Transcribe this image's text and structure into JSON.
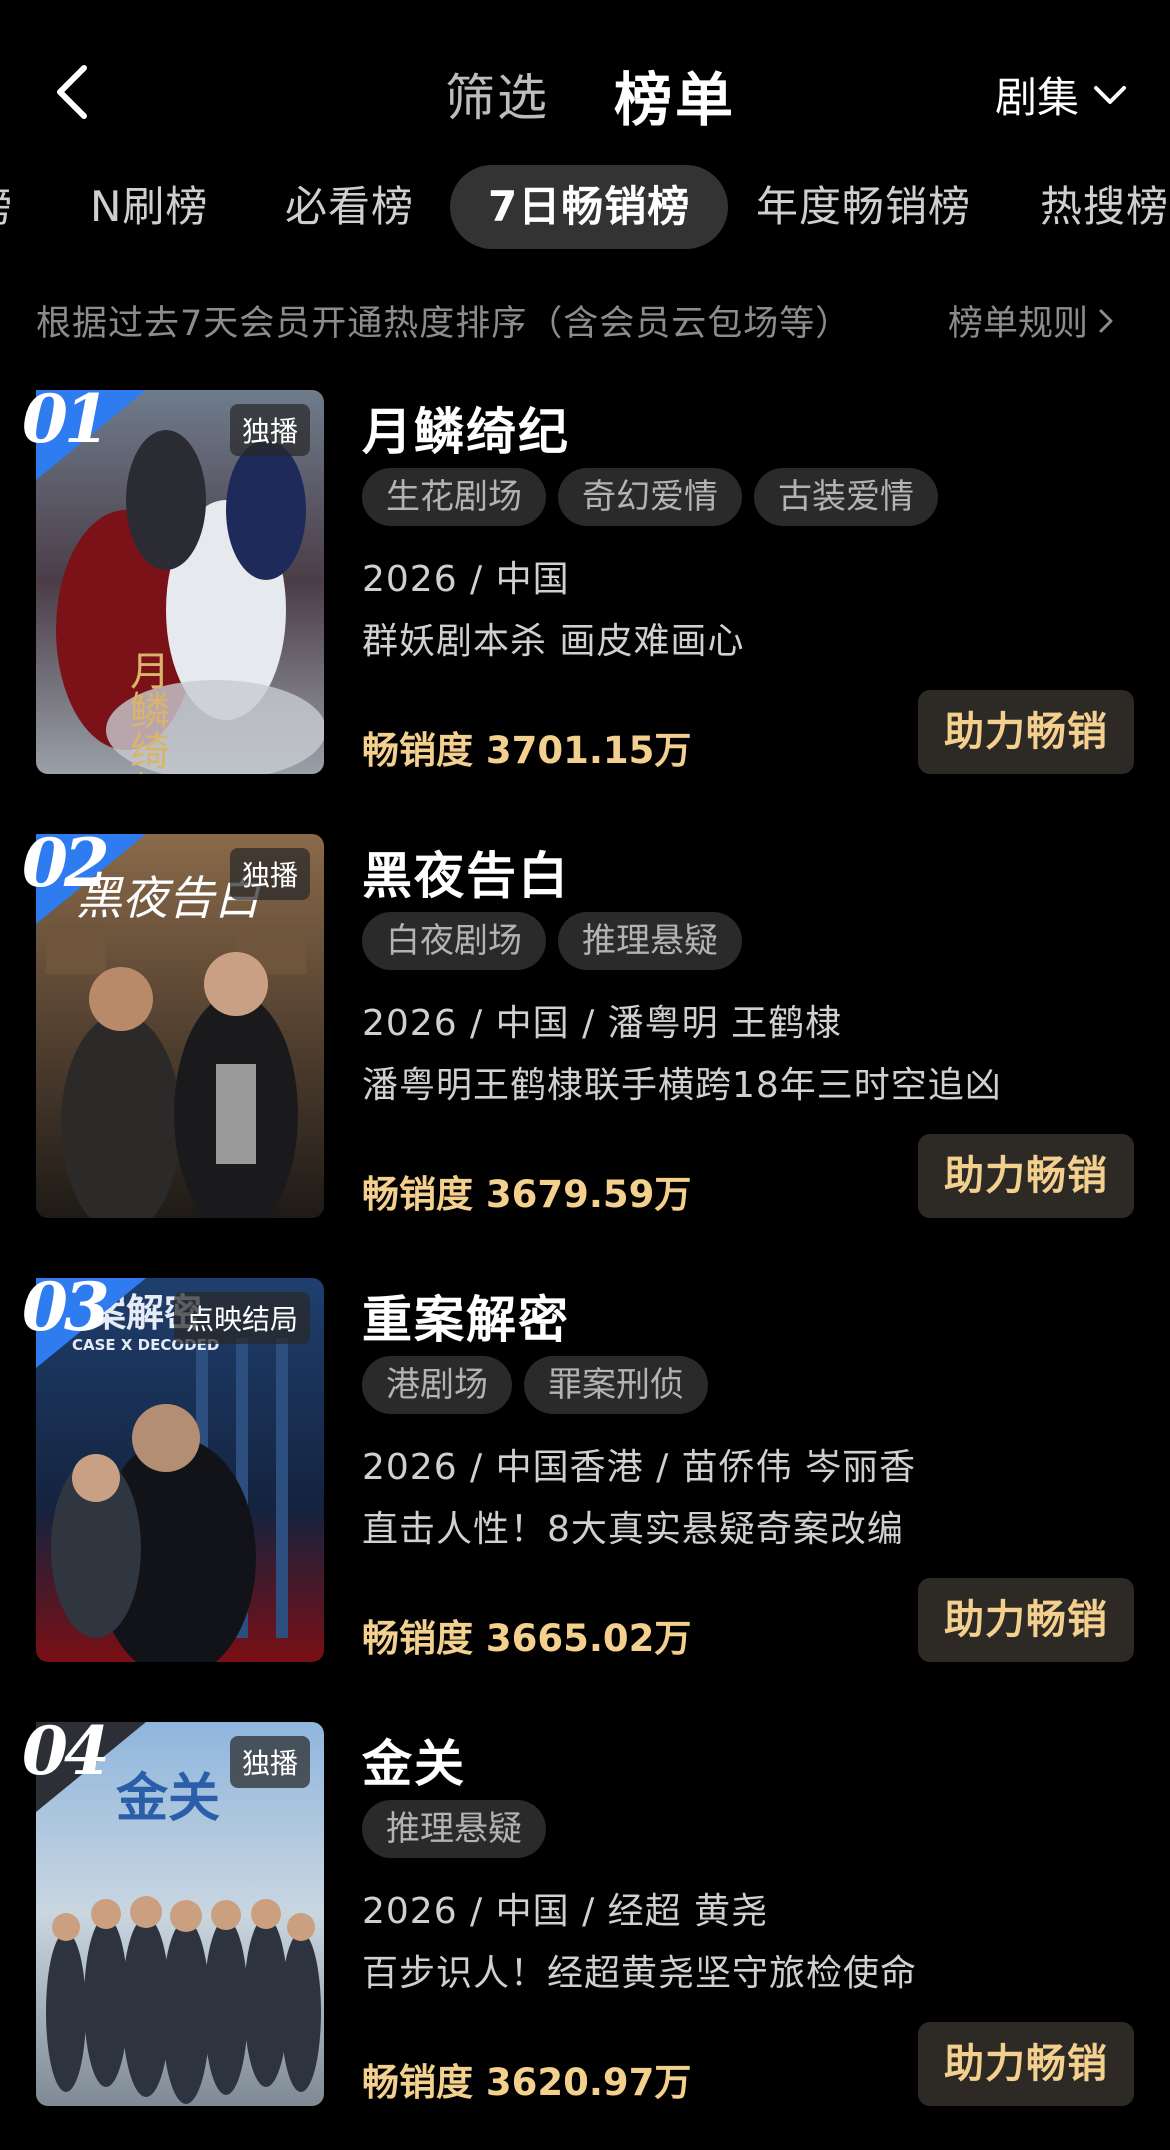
{
  "nav": {
    "filter_label": "筛选",
    "rank_label": "榜单",
    "category_label": "剧集"
  },
  "tabs": [
    {
      "label": "榜"
    },
    {
      "label": "N刷榜"
    },
    {
      "label": "必看榜"
    },
    {
      "label": "7日畅销榜",
      "active": true
    },
    {
      "label": "年度畅销榜"
    },
    {
      "label": "热搜榜"
    }
  ],
  "rule_desc": "根据过去7天会员开通热度排序（含会员云包场等）",
  "rule_link": "榜单规则",
  "items": [
    {
      "rank": "01",
      "badge": "独播",
      "poster_text": "月鳞绮纪",
      "title": "月鳞绮纪",
      "tags": [
        "生花剧场",
        "奇幻爱情",
        "古装爱情"
      ],
      "meta": "2026 / 中国",
      "slogan": "群妖剧本杀 画皮难画心",
      "sales": "畅销度 3701.15万",
      "button": "助力畅销"
    },
    {
      "rank": "02",
      "badge": "独播",
      "poster_text": "黑夜告白",
      "title": "黑夜告白",
      "tags": [
        "白夜剧场",
        "推理悬疑"
      ],
      "meta": "2026 / 中国 / 潘粤明 王鹤棣",
      "slogan": "潘粤明王鹤棣联手横跨18年三时空追凶",
      "sales": "畅销度 3679.59万",
      "button": "助力畅销"
    },
    {
      "rank": "03",
      "badge": "点映结局",
      "poster_text": "重案解密",
      "poster_subtext": "CASE X DECODED",
      "title": "重案解密",
      "tags": [
        "港剧场",
        "罪案刑侦"
      ],
      "meta": "2026 / 中国香港 / 苗侨伟 岑丽香",
      "slogan": "直击人性！8大真实悬疑奇案改编",
      "sales": "畅销度 3665.02万",
      "button": "助力畅销"
    },
    {
      "rank": "04",
      "badge": "独播",
      "poster_text": "金关",
      "title": "金关",
      "tags": [
        "推理悬疑"
      ],
      "meta": "2026 / 中国 / 经超 黄尧",
      "slogan": "百步识人！经超黄尧坚守旅检使命",
      "sales": "畅销度 3620.97万",
      "button": "助力畅销"
    }
  ],
  "colors": {
    "background": "#000000",
    "accent_gold": "#f4d08f",
    "rank_blue": "#2f7bf0",
    "tab_active_bg": "#333333"
  }
}
